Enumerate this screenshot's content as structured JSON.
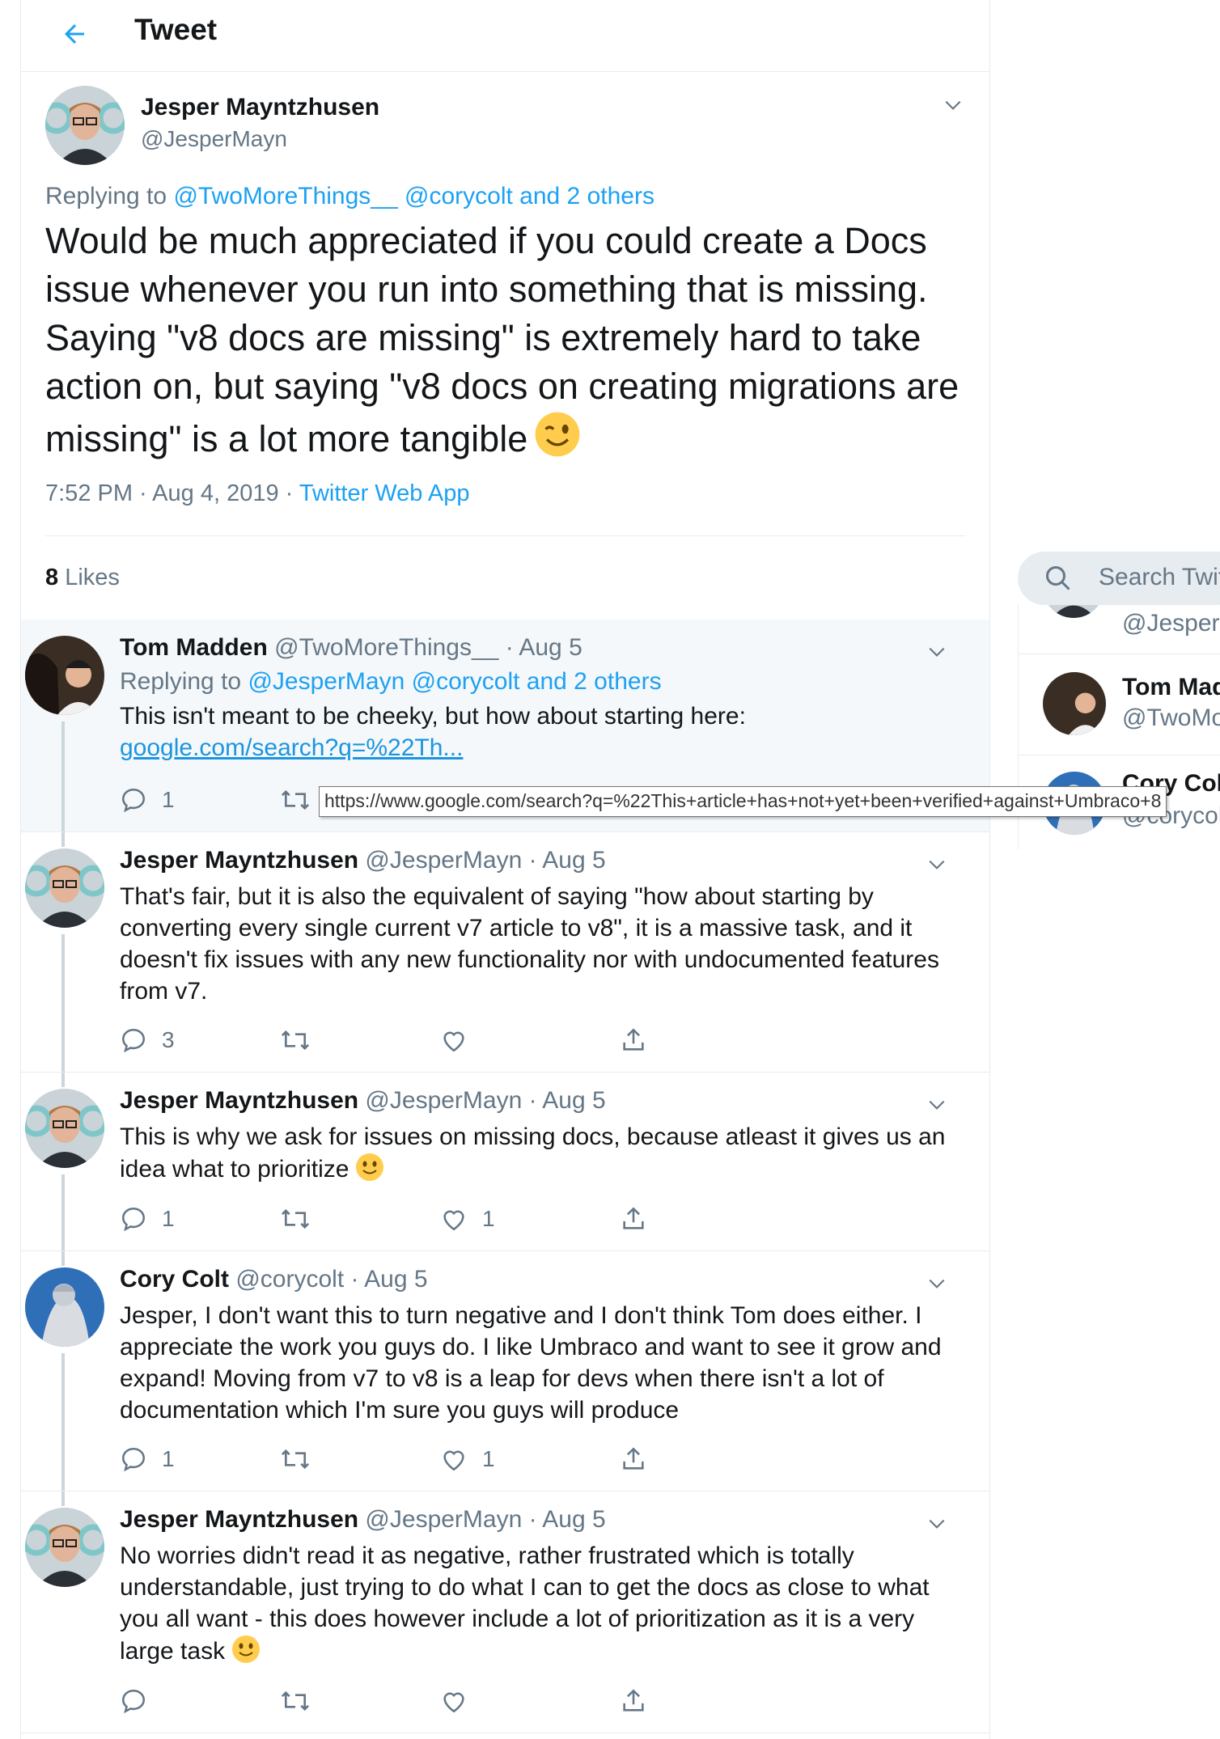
{
  "header": {
    "title": "Tweet"
  },
  "focus": {
    "name": "Jesper Mayntzhusen",
    "handle": "@JesperMayn",
    "replying_prefix": "Replying to ",
    "replying_mentions": "@TwoMoreThings__ @corycolt and 2 others",
    "text": "Would be much appreciated if you could create a Docs issue whenever you run into something that is missing. Saying \"v8 docs are missing\" is extremely hard to take action on, but saying \"v8 docs on creating migrations are missing\" is a lot more tangible",
    "emoji": "winking-face",
    "time": "7:52 PM · Aug 4, 2019 · ",
    "source": "Twitter Web App",
    "likes_count": "8",
    "likes_label": " Likes"
  },
  "replies": [
    {
      "name": "Tom Madden",
      "meta": " @TwoMoreThings__ · Aug 5",
      "replying_prefix": "Replying to ",
      "replying_mentions": "@JesperMayn @corycolt and 2 others",
      "text": "This isn't meant to be cheeky, but how about starting here:",
      "link": "google.com/search?q=%22Th...",
      "reply_count": "1"
    },
    {
      "name": "Jesper Mayntzhusen",
      "meta": " @JesperMayn · Aug 5",
      "text": "That's fair, but it is also the equivalent of saying \"how about starting by converting every single current v7 article to v8\", it is a massive task, and it doesn't fix issues with any new functionality nor with undocumented features from v7.",
      "reply_count": "3",
      "like_count": ""
    },
    {
      "name": "Jesper Mayntzhusen",
      "meta": " @JesperMayn · Aug 5",
      "text": "This is why we ask for issues on missing docs, because atleast it gives us an idea what to prioritize",
      "emoji": "slightly-smiling-face",
      "reply_count": "1",
      "like_count": "1"
    },
    {
      "name": "Cory Colt",
      "meta": " @corycolt · Aug 5",
      "text": "Jesper, I don't want this to turn negative and I don't think Tom does either. I appreciate the work you guys do. I like Umbraco and want to see it grow and expand! Moving from v7 to v8 is a leap for devs when there isn't a lot of documentation which I'm sure you guys will produce",
      "reply_count": "1",
      "like_count": "1"
    },
    {
      "name": "Jesper Mayntzhusen",
      "meta": " @JesperMayn · Aug 5",
      "text": "No worries didn't read it as negative, rather frustrated which is totally understandable, just trying to do what I can to get the docs as close to what you all want - this does however include a lot of prioritization as it is a very large task",
      "emoji": "slightly-smiling-face",
      "reply_count": "",
      "like_count": ""
    }
  ],
  "tooltip": {
    "url": "https://www.google.com/search?q=%22This+article+has+not+yet+been+verified+against+Umbraco+8"
  },
  "sidebar": {
    "search_placeholder": "Search Twitter",
    "items": [
      {
        "name": "",
        "handle": "@JesperMayn"
      },
      {
        "name": "Tom Madden",
        "handle": "@TwoMoreThings__"
      },
      {
        "name": "Cory Colt",
        "handle": "@corycolt"
      }
    ]
  },
  "colors": {
    "accent": "#1da1f2",
    "muted": "#657786",
    "border": "#e6ecf0",
    "highlight": "#f5f8fa"
  }
}
